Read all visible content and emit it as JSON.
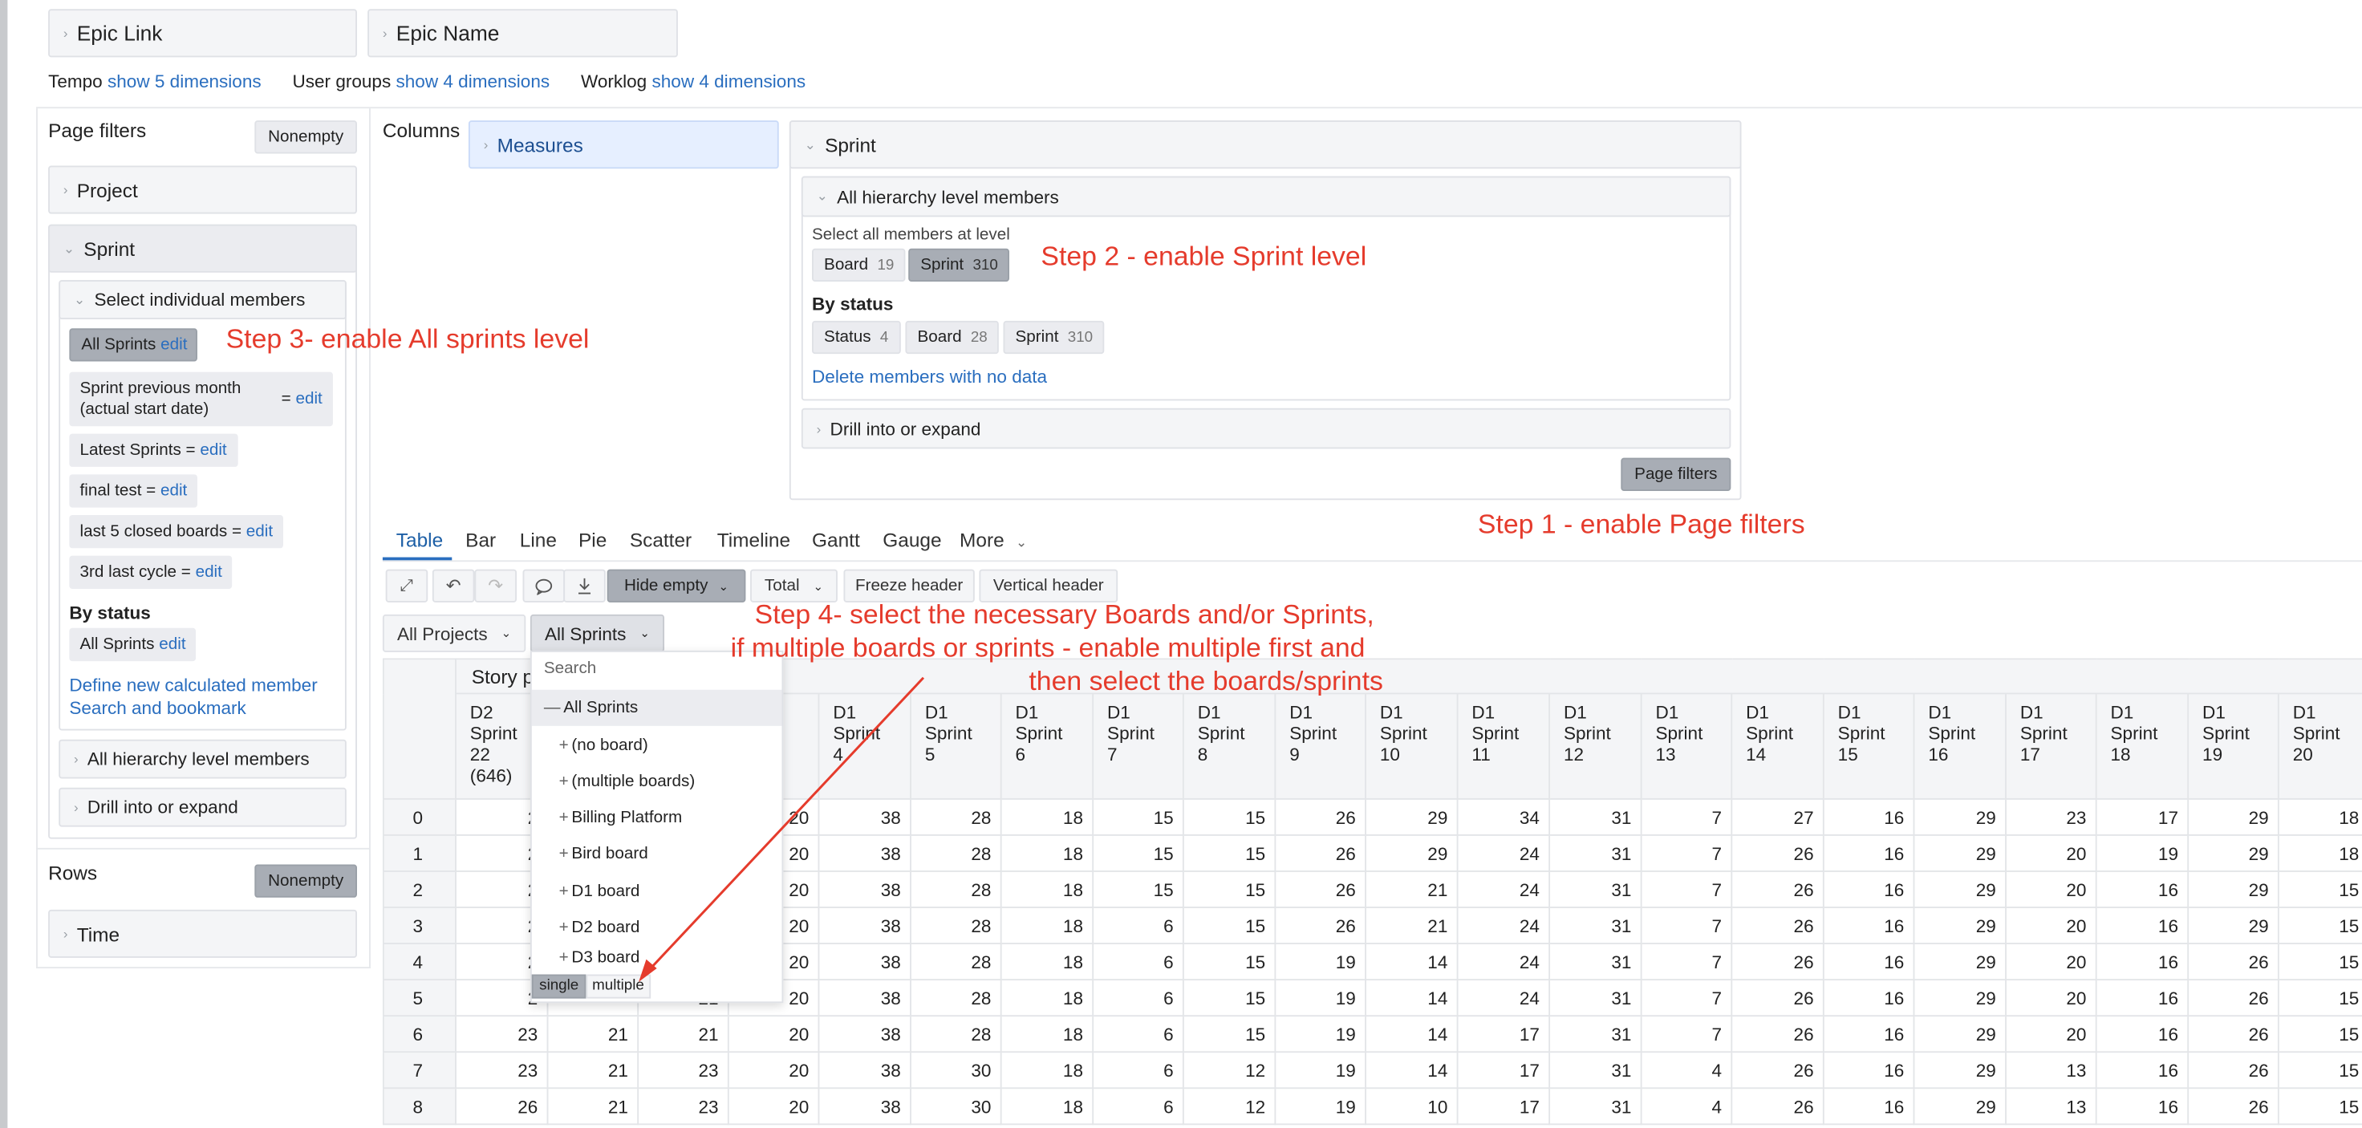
{
  "top": {
    "epic_link": "Epic Link",
    "epic_name": "Epic Name",
    "dims": [
      {
        "label": "Tempo",
        "link": "show 5 dimensions"
      },
      {
        "label": "User groups",
        "link": "show 4 dimensions"
      },
      {
        "label": "Worklog",
        "link": "show 4 dimensions"
      }
    ]
  },
  "left": {
    "page_filters": "Page filters",
    "nonempty": "Nonempty",
    "project": "Project",
    "sprint": "Sprint",
    "select_individual": "Select individual members",
    "members": [
      {
        "text": "All Sprints",
        "edit": "edit"
      },
      {
        "line1": "Sprint previous month",
        "line2": "(actual start date)",
        "eq": "=",
        "edit": "edit"
      },
      {
        "text": "Latest Sprints =",
        "edit": "edit"
      },
      {
        "text": "final test =",
        "edit": "edit"
      },
      {
        "text": "last 5 closed boards =",
        "edit": "edit"
      },
      {
        "text": "3rd last cycle =",
        "edit": "edit"
      }
    ],
    "by_status": "By status",
    "status_member": {
      "text": "All Sprints",
      "edit": "edit"
    },
    "define_new": "Define new calculated member",
    "search_bookmark": "Search and bookmark",
    "all_hierarchy": "All hierarchy level members",
    "drill": "Drill into or expand",
    "rows": "Rows",
    "rows_nonempty": "Nonempty",
    "time": "Time"
  },
  "columns": {
    "label": "Columns",
    "measures": "Measures",
    "sprint": "Sprint",
    "all_hierarchy": "All hierarchy level members",
    "select_all_at_level": "Select all members at level",
    "level_chips": [
      {
        "name": "Board",
        "count": "19"
      },
      {
        "name": "Sprint",
        "count": "310"
      }
    ],
    "by_status": "By status",
    "status_chips": [
      {
        "name": "Status",
        "count": "4"
      },
      {
        "name": "Board",
        "count": "28"
      },
      {
        "name": "Sprint",
        "count": "310"
      }
    ],
    "delete_members": "Delete members with no data",
    "drill": "Drill into or expand",
    "page_filters_btn": "Page filters"
  },
  "annotations": {
    "step1": "Step 1 - enable Page filters",
    "step2": "Step 2 - enable Sprint level",
    "step3": "Step 3- enable All sprints level",
    "step4_l1": "Step 4- select the necessary Boards and/or Sprints,",
    "step4_l2": "if multiple boards or sprints  - enable multiple first and",
    "step4_l3": "then select the boards/sprints",
    "arrow_color": "#e53b2c"
  },
  "tabs": [
    "Table",
    "Bar",
    "Line",
    "Pie",
    "Scatter",
    "Timeline",
    "Gantt",
    "Gauge",
    "More"
  ],
  "toolbar": {
    "hide_empty": "Hide empty",
    "total": "Total",
    "freeze_header": "Freeze header",
    "vertical_header": "Vertical header"
  },
  "filters": {
    "all_projects": "All Projects",
    "all_sprints": "All Sprints"
  },
  "dropdown": {
    "search_placeholder": "Search",
    "all": "All Sprints",
    "items": [
      "(no board)",
      "(multiple boards)",
      "Billing Platform",
      "Bird board",
      "D1 board",
      "D2 board",
      "D3 board"
    ],
    "single": "single",
    "multiple": "multiple"
  },
  "table": {
    "group_header": "Story p",
    "columns": [
      [
        "D2",
        "Sprint",
        "22",
        "(646)"
      ],
      [
        "",
        "",
        "",
        ""
      ],
      [
        "",
        "",
        "",
        ""
      ],
      [
        "",
        "nt",
        "",
        ""
      ],
      [
        "D1",
        "Sprint",
        "4",
        ""
      ],
      [
        "D1",
        "Sprint",
        "5",
        ""
      ],
      [
        "D1",
        "Sprint",
        "6",
        ""
      ],
      [
        "D1",
        "Sprint",
        "7",
        ""
      ],
      [
        "D1",
        "Sprint",
        "8",
        ""
      ],
      [
        "D1",
        "Sprint",
        "9",
        ""
      ],
      [
        "D1",
        "Sprint",
        "10",
        ""
      ],
      [
        "D1",
        "Sprint",
        "11",
        ""
      ],
      [
        "D1",
        "Sprint",
        "12",
        ""
      ],
      [
        "D1",
        "Sprint",
        "13",
        ""
      ],
      [
        "D1",
        "Sprint",
        "14",
        ""
      ],
      [
        "D1",
        "Sprint",
        "15",
        ""
      ],
      [
        "D1",
        "Sprint",
        "16",
        ""
      ],
      [
        "D1",
        "Sprint",
        "17",
        ""
      ],
      [
        "D1",
        "Sprint",
        "18",
        ""
      ],
      [
        "D1",
        "Sprint",
        "19",
        ""
      ],
      [
        "D1",
        "Sprint",
        "20",
        ""
      ]
    ],
    "rows": [
      {
        "label": "0",
        "values": [
          "2",
          "",
          "",
          "20",
          "38",
          "28",
          "18",
          "15",
          "15",
          "26",
          "29",
          "34",
          "31",
          "7",
          "27",
          "16",
          "29",
          "23",
          "17",
          "29",
          "18"
        ]
      },
      {
        "label": "1",
        "values": [
          "2",
          "",
          "",
          "20",
          "38",
          "28",
          "18",
          "15",
          "15",
          "26",
          "29",
          "24",
          "31",
          "7",
          "26",
          "16",
          "29",
          "20",
          "19",
          "29",
          "18"
        ]
      },
      {
        "label": "2",
        "values": [
          "2",
          "",
          "",
          "20",
          "38",
          "28",
          "18",
          "15",
          "15",
          "26",
          "21",
          "24",
          "31",
          "7",
          "26",
          "16",
          "29",
          "20",
          "16",
          "29",
          "15"
        ]
      },
      {
        "label": "3",
        "values": [
          "2",
          "",
          "",
          "20",
          "38",
          "28",
          "18",
          "6",
          "15",
          "26",
          "21",
          "24",
          "31",
          "7",
          "26",
          "16",
          "29",
          "20",
          "16",
          "29",
          "15"
        ]
      },
      {
        "label": "4",
        "values": [
          "2",
          "",
          "",
          "20",
          "38",
          "28",
          "18",
          "6",
          "15",
          "19",
          "14",
          "24",
          "31",
          "7",
          "26",
          "16",
          "29",
          "20",
          "16",
          "26",
          "15"
        ]
      },
      {
        "label": "5",
        "values": [
          "2",
          "",
          "21",
          "20",
          "38",
          "28",
          "18",
          "6",
          "15",
          "19",
          "14",
          "24",
          "31",
          "7",
          "26",
          "16",
          "29",
          "20",
          "16",
          "26",
          "15"
        ]
      },
      {
        "label": "6",
        "values": [
          "23",
          "21",
          "21",
          "20",
          "38",
          "28",
          "18",
          "6",
          "15",
          "19",
          "14",
          "17",
          "31",
          "7",
          "26",
          "16",
          "29",
          "20",
          "16",
          "26",
          "15"
        ]
      },
      {
        "label": "7",
        "values": [
          "23",
          "21",
          "23",
          "20",
          "38",
          "30",
          "18",
          "6",
          "12",
          "19",
          "14",
          "17",
          "31",
          "4",
          "26",
          "16",
          "29",
          "13",
          "16",
          "26",
          "15"
        ]
      },
      {
        "label": "8",
        "values": [
          "26",
          "21",
          "23",
          "20",
          "38",
          "30",
          "18",
          "6",
          "12",
          "19",
          "10",
          "17",
          "31",
          "4",
          "26",
          "16",
          "29",
          "13",
          "16",
          "26",
          "15"
        ]
      }
    ]
  }
}
